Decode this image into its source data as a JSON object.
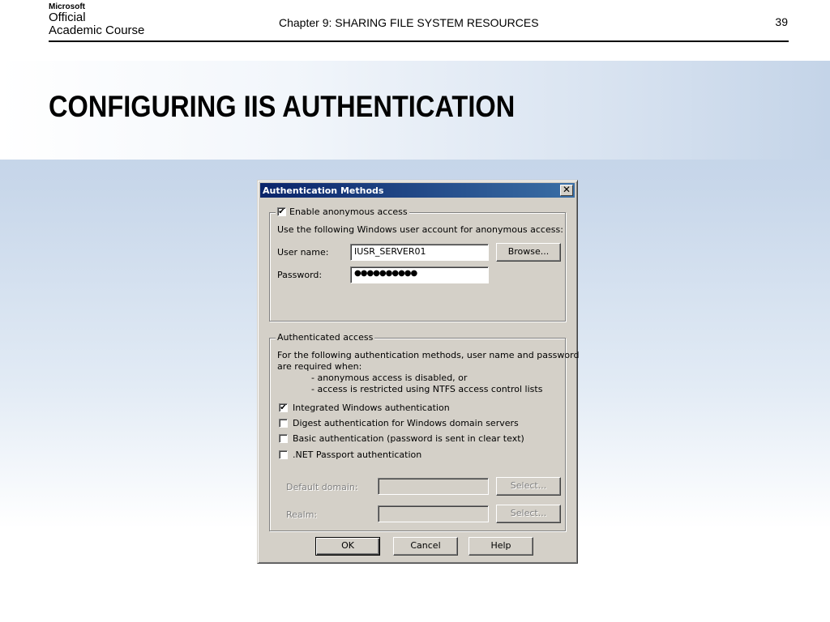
{
  "slide": {
    "logo": {
      "brand": "Microsoft",
      "line1": "Official",
      "line2": "Academic Course"
    },
    "chapter": "Chapter 9: SHARING FILE SYSTEM RESOURCES",
    "page_number": "39",
    "title": "CONFIGURING IIS AUTHENTICATION"
  },
  "dialog": {
    "title": "Authentication Methods",
    "close_glyph": "✕",
    "anonymous": {
      "checkbox_label": "Enable anonymous access",
      "checked": true,
      "description": "Use the following Windows user account for anonymous access:",
      "username_label": "User name:",
      "username_value": "IUSR_SERVER01",
      "browse_button": "Browse...",
      "password_label": "Password:",
      "password_value": "●●●●●●●●●●"
    },
    "authenticated": {
      "group_label": "Authenticated access",
      "desc_line1": "For the following authentication methods, user name and password",
      "desc_line2": "are required when:",
      "desc_bullet1": "- anonymous access is disabled, or",
      "desc_bullet2": "- access is restricted using NTFS access control lists",
      "options": [
        {
          "label": "Integrated Windows authentication",
          "checked": true
        },
        {
          "label": "Digest authentication for Windows domain servers",
          "checked": false
        },
        {
          "label": "Basic authentication (password is sent in clear text)",
          "checked": false
        },
        {
          "label": ".NET Passport authentication",
          "checked": false
        }
      ],
      "default_domain_label": "Default domain:",
      "realm_label": "Realm:",
      "select_button_1": "Select...",
      "select_button_2": "Select..."
    },
    "buttons": {
      "ok": "OK",
      "cancel": "Cancel",
      "help": "Help"
    }
  }
}
